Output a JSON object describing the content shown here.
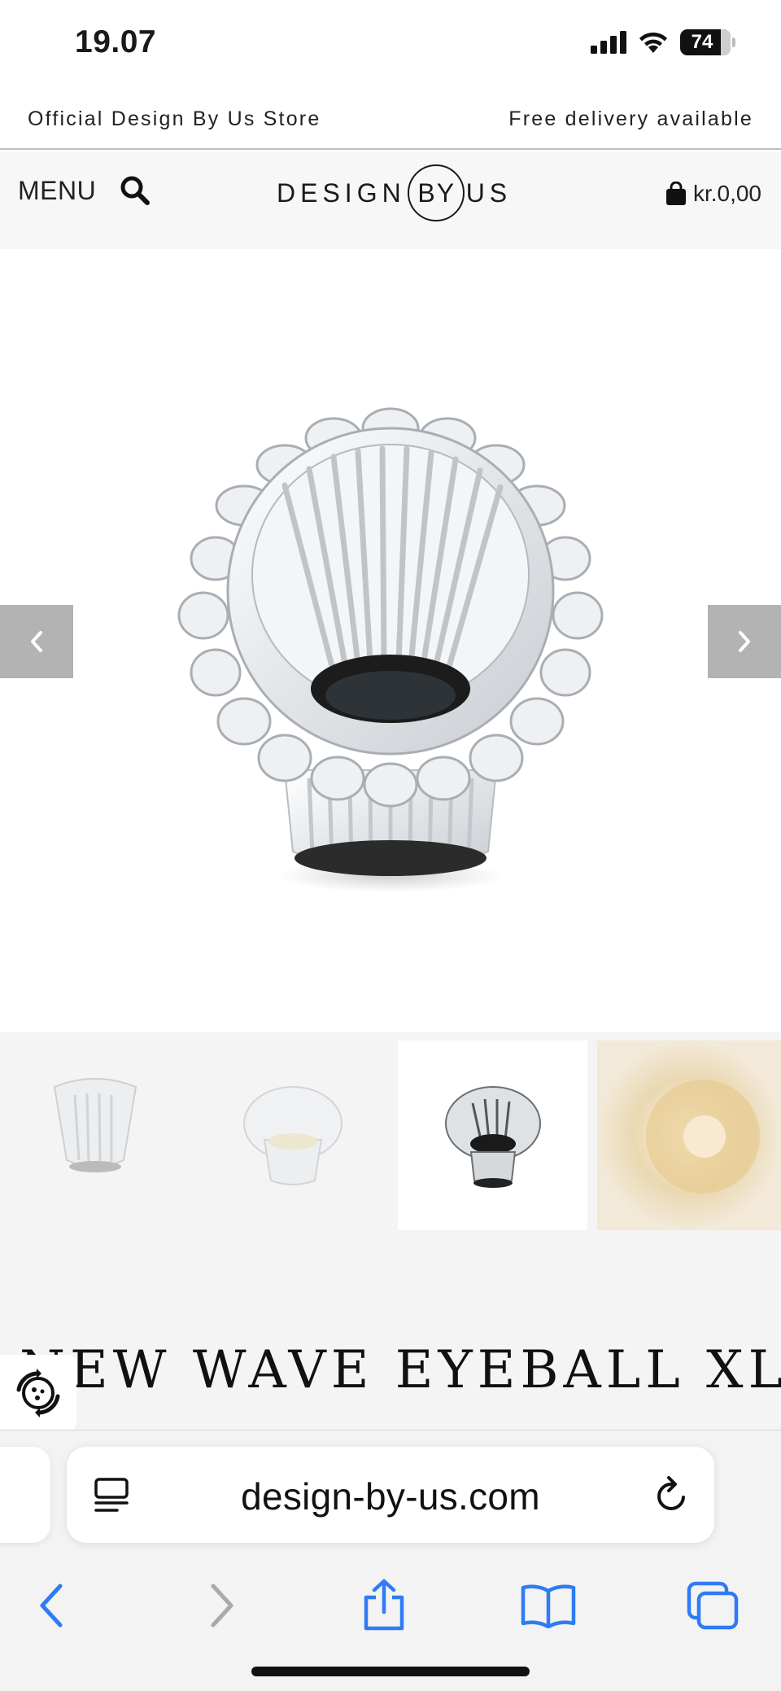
{
  "status_bar": {
    "time": "19.07",
    "battery": "74"
  },
  "announcement": {
    "left": "Official Design By Us Store",
    "right": "Free delivery available"
  },
  "header": {
    "menu_label": "MENU",
    "logo_left": "DESIGN",
    "logo_mid": "BY",
    "logo_right": "US",
    "cart_total": "kr.0,00"
  },
  "product": {
    "title": "NEW WAVE EYEBALL XL"
  },
  "browser": {
    "url": "design-by-us.com"
  },
  "colors": {
    "header_bg": "#f7f7f7",
    "arrow_bg": "#b3b3b3",
    "safari_blue": "#2f7bf6"
  },
  "icons": [
    "search-icon",
    "bag-icon",
    "chevron-left-icon",
    "chevron-right-icon",
    "cookie-icon",
    "reader-icon",
    "reload-icon",
    "back-icon",
    "forward-icon",
    "share-icon",
    "bookmarks-icon",
    "tabs-icon"
  ]
}
